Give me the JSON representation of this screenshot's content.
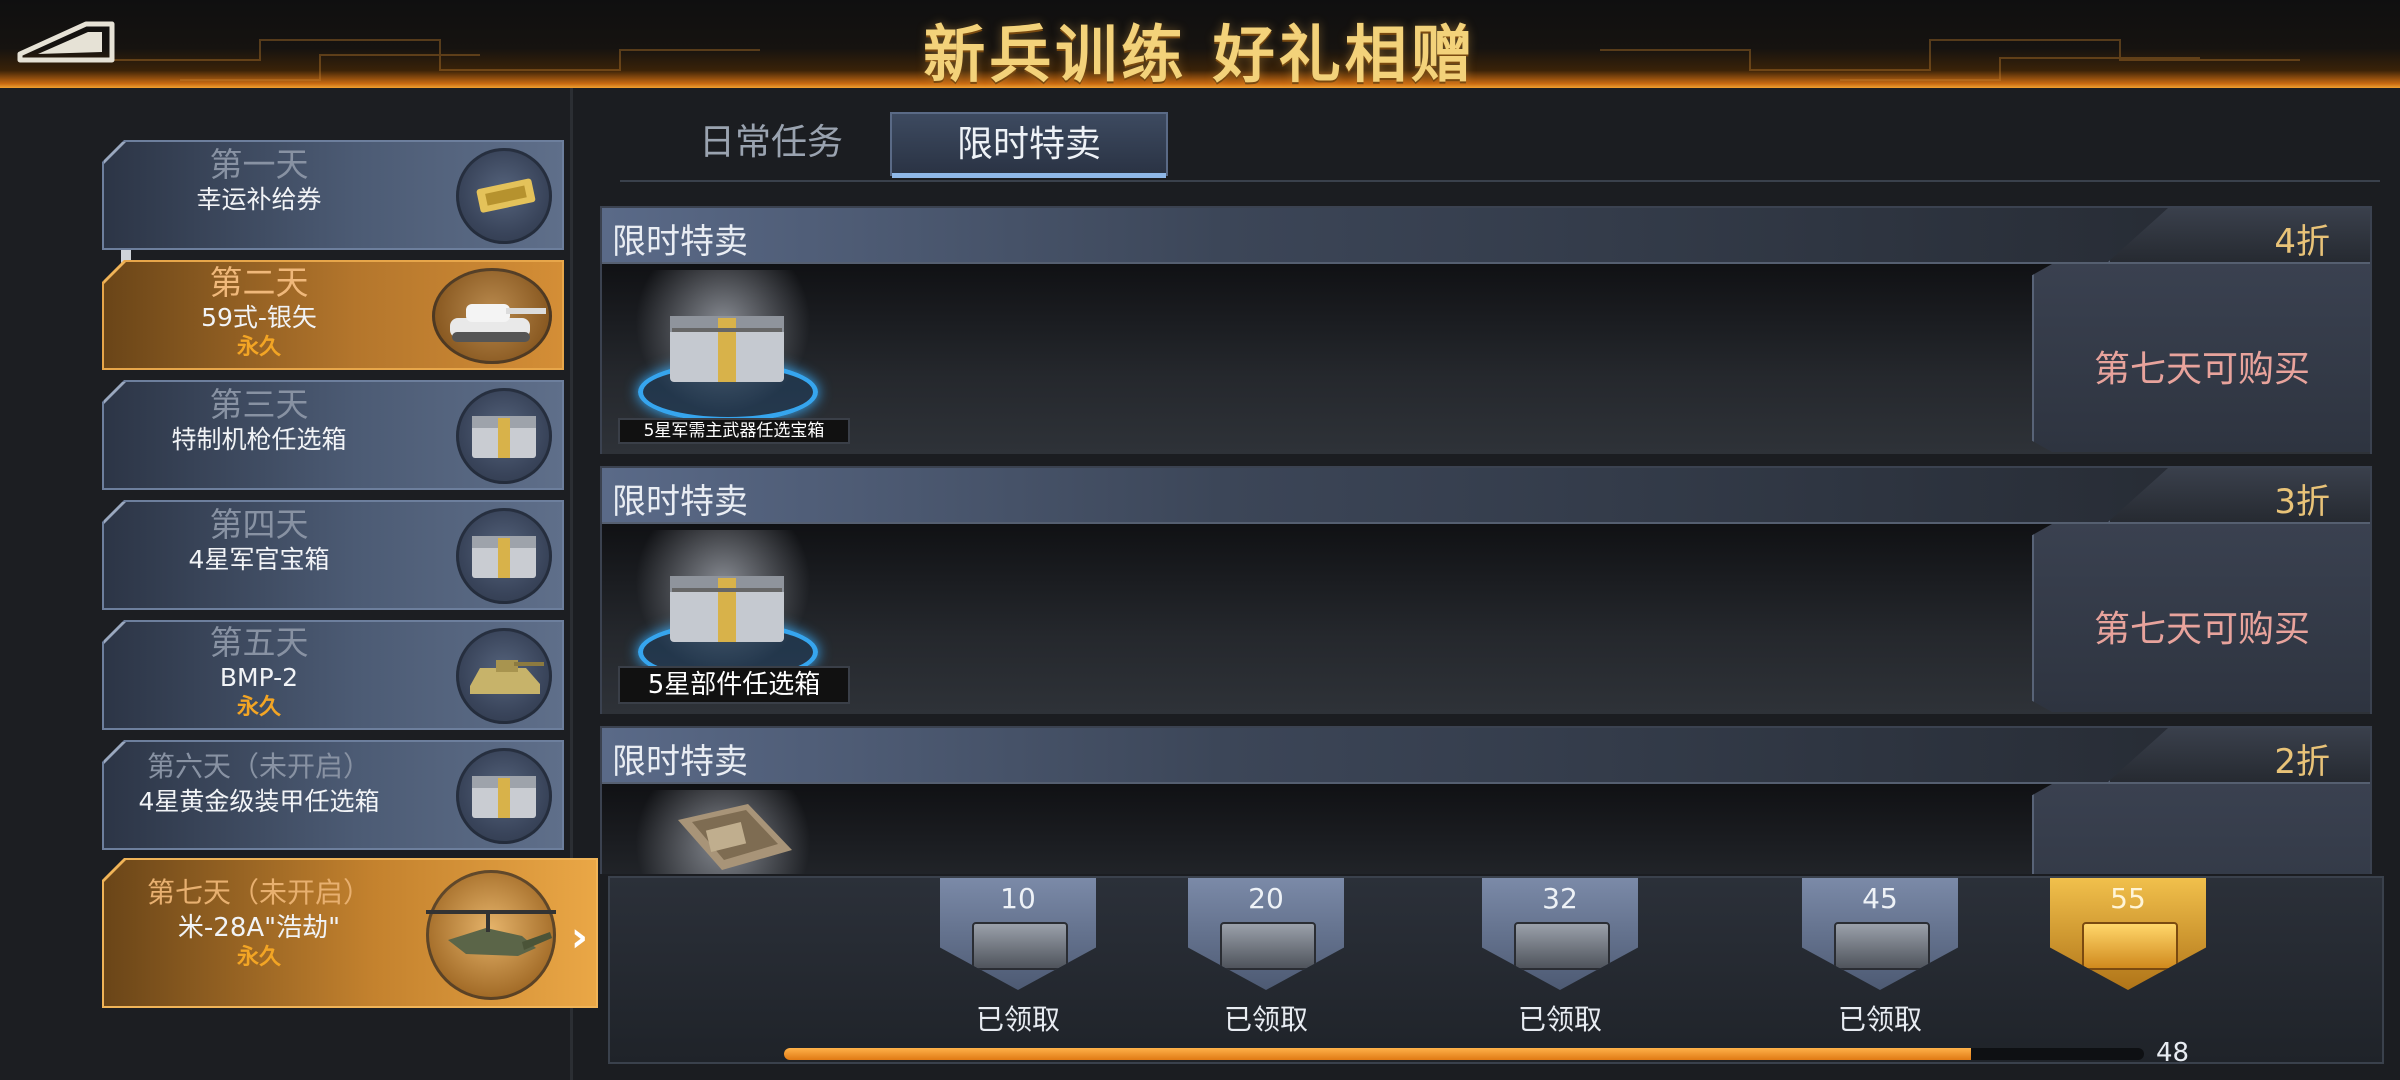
{
  "header": {
    "title": "新兵训练 好礼相赠"
  },
  "days": [
    {
      "label": "第一天",
      "item": "幸运补给券",
      "perm": "",
      "icon": "coupon-icon"
    },
    {
      "label": "第二天",
      "item": "59式-银矢",
      "perm": "永久",
      "icon": "tank-icon"
    },
    {
      "label": "第三天",
      "item": "特制机枪任选箱",
      "perm": "",
      "icon": "crate-icon"
    },
    {
      "label": "第四天",
      "item": "4星军官宝箱",
      "perm": "",
      "icon": "crate-icon"
    },
    {
      "label": "第五天",
      "item": "BMP-2",
      "perm": "永久",
      "icon": "armored-vehicle-icon"
    },
    {
      "label": "第六天（未开启）",
      "item": "4星黄金级装甲任选箱",
      "perm": "",
      "icon": "crate-icon"
    },
    {
      "label": "第七天（未开启）",
      "item": "米-28A\"浩劫\"",
      "perm": "永久",
      "icon": "helicopter-icon"
    }
  ],
  "tabs": {
    "daily": "日常任务",
    "sale": "限时特卖"
  },
  "sales": [
    {
      "title": "限时特卖",
      "discount": "4折",
      "item": "5星军需主武器任选宝箱",
      "button": "第七天可购买"
    },
    {
      "title": "限时特卖",
      "discount": "3折",
      "item": "5星部件任选箱",
      "button": "第七天可购买"
    },
    {
      "title": "限时特卖",
      "discount": "2折",
      "item": "",
      "button": ""
    }
  ],
  "rewards": [
    {
      "points": "10",
      "status": "已领取"
    },
    {
      "points": "20",
      "status": "已领取"
    },
    {
      "points": "32",
      "status": "已领取"
    },
    {
      "points": "45",
      "status": "已领取"
    },
    {
      "points": "55",
      "status": ""
    }
  ],
  "progress": {
    "value": "48",
    "fraction": 0.873
  },
  "colors": {
    "accent_gold": "#f3d27a",
    "active_orange": "#d48e36",
    "progress": "#f0a030"
  }
}
